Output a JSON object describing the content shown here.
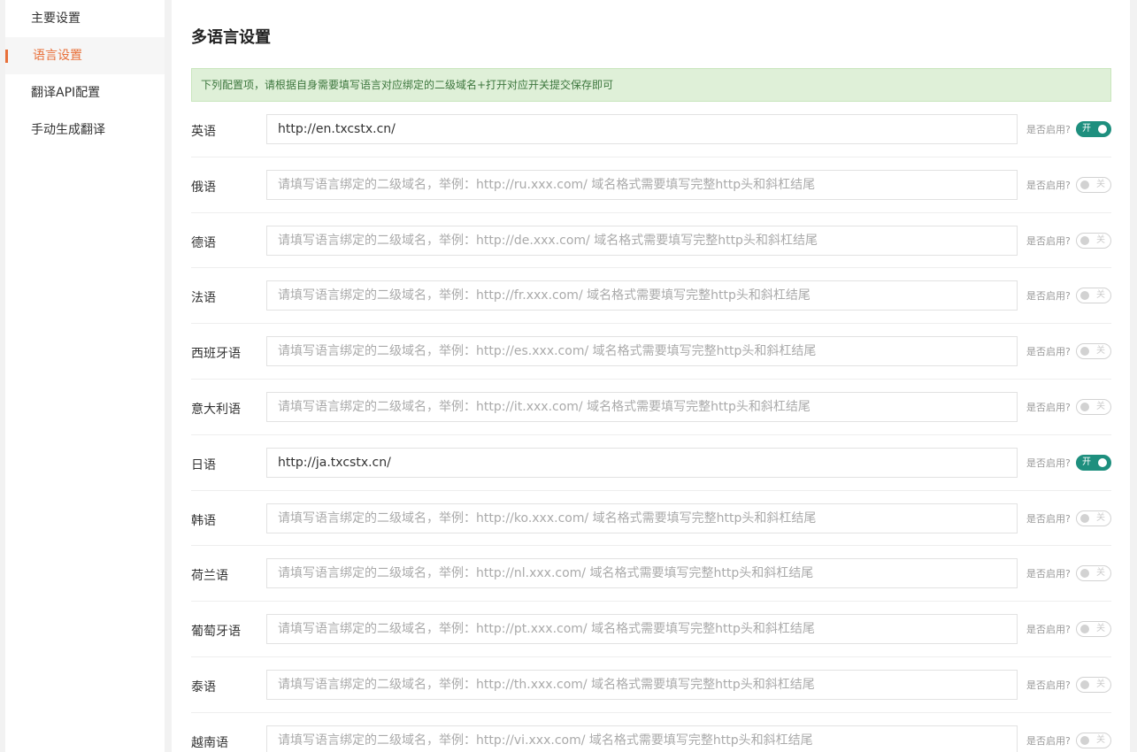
{
  "sidebar": {
    "items": [
      {
        "label": "主要设置",
        "active": false
      },
      {
        "label": "语言设置",
        "active": true
      },
      {
        "label": "翻译API配置",
        "active": false
      },
      {
        "label": "手动生成翻译",
        "active": false
      }
    ]
  },
  "main": {
    "title": "多语言设置",
    "notice": "下列配置项，请根据自身需要填写语言对应绑定的二级域名+打开对应开关提交保存即可",
    "enable_label": "是否启用?",
    "switch_on_text": "开",
    "switch_off_text": "关",
    "languages": [
      {
        "name": "英语",
        "value": "http://en.txcstx.cn/",
        "placeholder": "请填写语言绑定的二级域名，举例：http://en.xxx.com/ 域名格式需要填写完整http头和斜杠结尾",
        "enabled": true
      },
      {
        "name": "俄语",
        "value": "",
        "placeholder": "请填写语言绑定的二级域名，举例：http://ru.xxx.com/ 域名格式需要填写完整http头和斜杠结尾",
        "enabled": false
      },
      {
        "name": "德语",
        "value": "",
        "placeholder": "请填写语言绑定的二级域名，举例：http://de.xxx.com/ 域名格式需要填写完整http头和斜杠结尾",
        "enabled": false
      },
      {
        "name": "法语",
        "value": "",
        "placeholder": "请填写语言绑定的二级域名，举例：http://fr.xxx.com/ 域名格式需要填写完整http头和斜杠结尾",
        "enabled": false
      },
      {
        "name": "西班牙语",
        "value": "",
        "placeholder": "请填写语言绑定的二级域名，举例：http://es.xxx.com/ 域名格式需要填写完整http头和斜杠结尾",
        "enabled": false
      },
      {
        "name": "意大利语",
        "value": "",
        "placeholder": "请填写语言绑定的二级域名，举例：http://it.xxx.com/ 域名格式需要填写完整http头和斜杠结尾",
        "enabled": false
      },
      {
        "name": "日语",
        "value": "http://ja.txcstx.cn/",
        "placeholder": "请填写语言绑定的二级域名，举例：http://ja.xxx.com/ 域名格式需要填写完整http头和斜杠结尾",
        "enabled": true
      },
      {
        "name": "韩语",
        "value": "",
        "placeholder": "请填写语言绑定的二级域名，举例：http://ko.xxx.com/ 域名格式需要填写完整http头和斜杠结尾",
        "enabled": false
      },
      {
        "name": "荷兰语",
        "value": "",
        "placeholder": "请填写语言绑定的二级域名，举例：http://nl.xxx.com/ 域名格式需要填写完整http头和斜杠结尾",
        "enabled": false
      },
      {
        "name": "葡萄牙语",
        "value": "",
        "placeholder": "请填写语言绑定的二级域名，举例：http://pt.xxx.com/ 域名格式需要填写完整http头和斜杠结尾",
        "enabled": false
      },
      {
        "name": "泰语",
        "value": "",
        "placeholder": "请填写语言绑定的二级域名，举例：http://th.xxx.com/ 域名格式需要填写完整http头和斜杠结尾",
        "enabled": false
      },
      {
        "name": "越南语",
        "value": "",
        "placeholder": "请填写语言绑定的二级域名，举例：http://vi.xxx.com/ 域名格式需要填写完整http头和斜杠结尾",
        "enabled": false
      }
    ]
  },
  "colors": {
    "accent": "#e8703a",
    "switch_on": "#1e8f7e",
    "notice_bg": "#dff0d8",
    "notice_text": "#3c763d"
  }
}
